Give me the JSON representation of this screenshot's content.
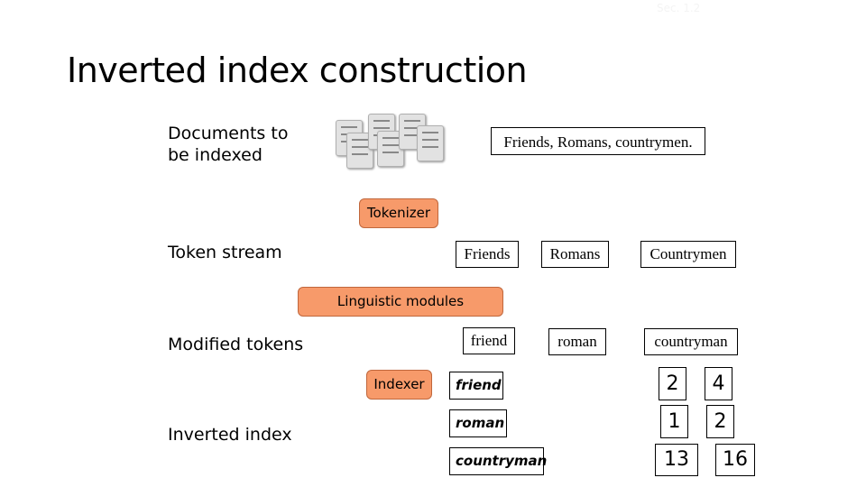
{
  "section_tag": "Sec. 1.2",
  "title": "Inverted index construction",
  "left_labels": {
    "documents": [
      "Documents to",
      "be indexed"
    ],
    "token_stream": "Token stream",
    "modified_tokens": "Modified tokens",
    "inverted_index": "Inverted index"
  },
  "stages": {
    "tokenizer": "Tokenizer",
    "linguistic": "Linguistic modules",
    "indexer": "Indexer"
  },
  "source_text": "Friends, Romans, countrymen.",
  "tokens": [
    "Friends",
    "Romans",
    "Countrymen"
  ],
  "modified_tokens": [
    "friend",
    "roman",
    "countryman"
  ],
  "index": [
    {
      "term": "friend",
      "postings": [
        "2",
        "4"
      ]
    },
    {
      "term": "roman",
      "postings": [
        "1",
        "2"
      ]
    },
    {
      "term": "countryman",
      "postings": [
        "13",
        "16"
      ]
    }
  ],
  "colors": {
    "stage_fill": "#f79a6a",
    "arrow_fill": "#4f8fd6"
  }
}
